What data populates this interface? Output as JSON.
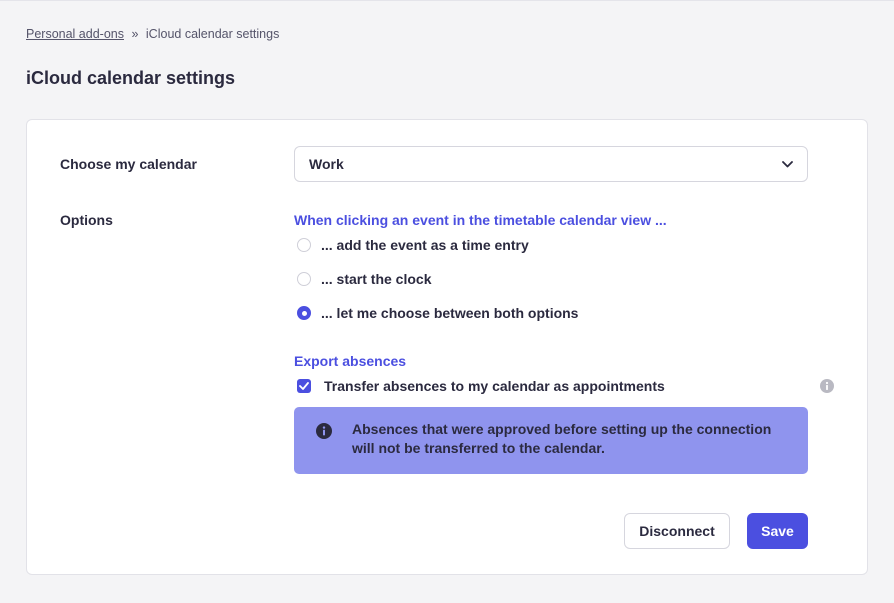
{
  "breadcrumb": {
    "parent": "Personal add-ons",
    "separator": "»",
    "current": "iCloud calendar settings"
  },
  "page": {
    "title": "iCloud calendar settings"
  },
  "calendar": {
    "label": "Choose my calendar",
    "selected": "Work",
    "icon": "chevron-down-icon"
  },
  "options": {
    "label": "Options",
    "click_section_title": "When clicking an event in the timetable calendar view ...",
    "radios": [
      {
        "label": "... add the event as a time entry",
        "checked": false
      },
      {
        "label": "... start the clock",
        "checked": false
      },
      {
        "label": "... let me choose between both options",
        "checked": true
      }
    ],
    "export_section_title": "Export absences",
    "transfer_checkbox": {
      "label": "Transfer absences to my calendar as appointments",
      "checked": true
    },
    "info_icon": "info-icon",
    "alert_text": "Absences that were approved before setting up the connection will not be transferred to the calendar."
  },
  "actions": {
    "disconnect": "Disconnect",
    "save": "Save"
  },
  "colors": {
    "accent": "#4b4fe0",
    "alert_bg": "#8f94ee",
    "text": "#2b2a3f",
    "background": "#f4f4f6"
  }
}
